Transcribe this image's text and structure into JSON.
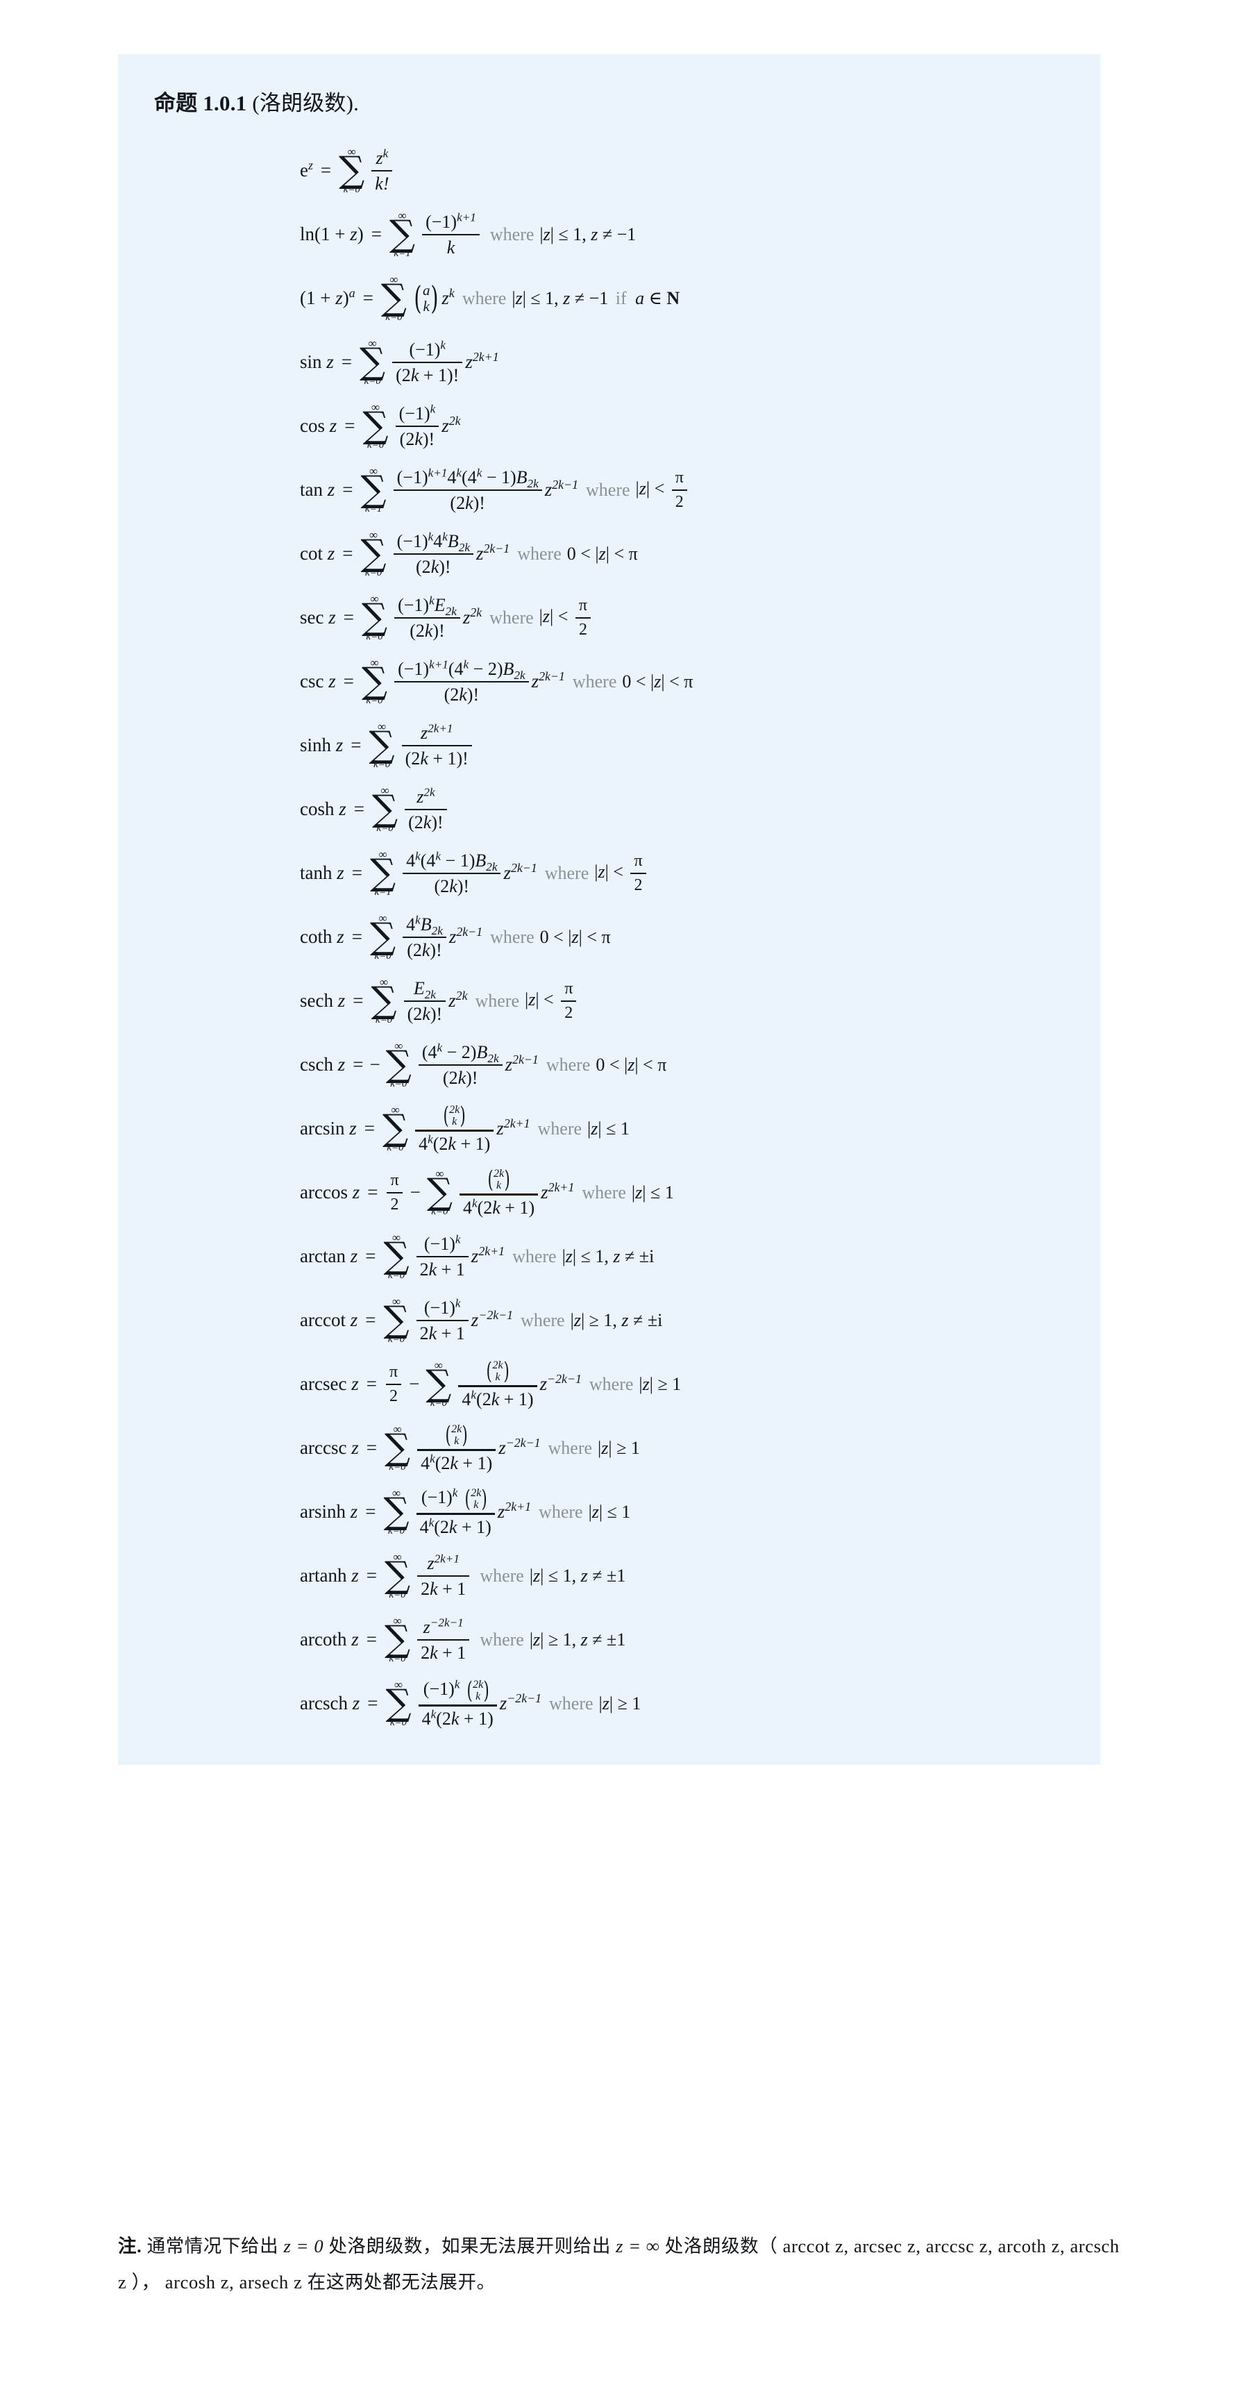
{
  "document": {
    "title_lead": "命题 1.0.1",
    "title_paren": "(洛朗级数).",
    "background_color": "#eaf4fb",
    "text_color": "#12161c",
    "where_color": "#8c9196"
  },
  "formulas": [
    {
      "id": "exp",
      "lhs": "e",
      "lhs_sup": "z",
      "sum_upper": "∞",
      "sum_lower": "k=0",
      "num": "z^k",
      "den": "k!",
      "where": "",
      "condition": ""
    },
    {
      "id": "ln",
      "lhs": "ln(1 + z)",
      "sum_upper": "∞",
      "sum_lower": "k=1",
      "num": "(−1)^{k+1}",
      "den": "k",
      "where": "where",
      "condition": "|z| ≤ 1, z ≠ −1"
    },
    {
      "id": "binomial",
      "lhs": "(1 + z)^a",
      "sum_upper": "∞",
      "sum_lower": "k=0",
      "binom_top": "a",
      "binom_bottom": "k",
      "factor": "z^k",
      "where": "where",
      "condition": "|z| ≤ 1, z ≠ −1 if a ∈ N"
    },
    {
      "id": "sin",
      "lhs": "sin z",
      "sum_upper": "∞",
      "sum_lower": "k=0",
      "num": "(−1)^k",
      "den": "(2k + 1)!",
      "factor": "z^{2k+1}",
      "where": "",
      "condition": ""
    },
    {
      "id": "cos",
      "lhs": "cos z",
      "sum_upper": "∞",
      "sum_lower": "k=0",
      "num": "(−1)^k",
      "den": "(2k)!",
      "factor": "z^{2k}",
      "where": "",
      "condition": ""
    },
    {
      "id": "tan",
      "lhs": "tan z",
      "sum_upper": "∞",
      "sum_lower": "k=1",
      "num": "(−1)^{k+1} 4^k (4^k − 1) B_{2k}",
      "den": "(2k)!",
      "factor": "z^{2k−1}",
      "where": "where",
      "condition": "|z| < π/2"
    },
    {
      "id": "cot",
      "lhs": "cot z",
      "sum_upper": "∞",
      "sum_lower": "k=0",
      "num": "(−1)^k 4^k B_{2k}",
      "den": "(2k)!",
      "factor": "z^{2k−1}",
      "where": "where",
      "condition": "0 < |z| < π"
    },
    {
      "id": "sec",
      "lhs": "sec z",
      "sum_upper": "∞",
      "sum_lower": "k=0",
      "num": "(−1)^k E_{2k}",
      "den": "(2k)!",
      "factor": "z^{2k}",
      "where": "where",
      "condition": "|z| < π/2"
    },
    {
      "id": "csc",
      "lhs": "csc z",
      "sum_upper": "∞",
      "sum_lower": "k=0",
      "num": "(−1)^{k+1} (4^k − 2) B_{2k}",
      "den": "(2k)!",
      "factor": "z^{2k−1}",
      "where": "where",
      "condition": "0 < |z| < π"
    },
    {
      "id": "sinh",
      "lhs": "sinh z",
      "sum_upper": "∞",
      "sum_lower": "k=0",
      "num": "z^{2k+1}",
      "den": "(2k + 1)!",
      "where": "",
      "condition": ""
    },
    {
      "id": "cosh",
      "lhs": "cosh z",
      "sum_upper": "∞",
      "sum_lower": "k=0",
      "num": "z^{2k}",
      "den": "(2k)!",
      "where": "",
      "condition": ""
    },
    {
      "id": "tanh",
      "lhs": "tanh z",
      "sum_upper": "∞",
      "sum_lower": "k=1",
      "num": "4^k (4^k − 1) B_{2k}",
      "den": "(2k)!",
      "factor": "z^{2k−1}",
      "where": "where",
      "condition": "|z| < π/2"
    },
    {
      "id": "coth",
      "lhs": "coth z",
      "sum_upper": "∞",
      "sum_lower": "k=0",
      "num": "4^k B_{2k}",
      "den": "(2k)!",
      "factor": "z^{2k−1}",
      "where": "where",
      "condition": "0 < |z| < π"
    },
    {
      "id": "sech",
      "lhs": "sech z",
      "sum_upper": "∞",
      "sum_lower": "k=0",
      "num": "E_{2k}",
      "den": "(2k)!",
      "factor": "z^{2k}",
      "where": "where",
      "condition": "|z| < π/2"
    },
    {
      "id": "csch",
      "lhs": "csch z",
      "leading_sign": "−",
      "sum_upper": "∞",
      "sum_lower": "k=0",
      "num": "(4^k − 2) B_{2k}",
      "den": "(2k)!",
      "factor": "z^{2k−1}",
      "where": "where",
      "condition": "0 < |z| < π"
    },
    {
      "id": "arcsin",
      "lhs": "arcsin z",
      "sum_upper": "∞",
      "sum_lower": "k=0",
      "num_binom_top": "2k",
      "num_binom_bottom": "k",
      "den": "4^k (2k + 1)",
      "factor": "z^{2k+1}",
      "where": "where",
      "condition": "|z| ≤ 1"
    },
    {
      "id": "arccos",
      "lhs": "arccos z",
      "prefix_frac_num": "π",
      "prefix_frac_den": "2",
      "prefix_sign": "−",
      "sum_upper": "∞",
      "sum_lower": "k=0",
      "num_binom_top": "2k",
      "num_binom_bottom": "k",
      "den": "4^k (2k + 1)",
      "factor": "z^{2k+1}",
      "where": "where",
      "condition": "|z| ≤ 1"
    },
    {
      "id": "arctan",
      "lhs": "arctan z",
      "sum_upper": "∞",
      "sum_lower": "k=0",
      "num": "(−1)^k",
      "den": "2k + 1",
      "factor": "z^{2k+1}",
      "where": "where",
      "condition": "|z| ≤ 1, z ≠ ±i"
    },
    {
      "id": "arccot",
      "lhs": "arccot z",
      "sum_upper": "∞",
      "sum_lower": "k=0",
      "num": "(−1)^k",
      "den": "2k + 1",
      "factor": "z^{−2k−1}",
      "where": "where",
      "condition": "|z| ≥ 1, z ≠ ±i"
    },
    {
      "id": "arcsec",
      "lhs": "arcsec z",
      "prefix_frac_num": "π",
      "prefix_frac_den": "2",
      "prefix_sign": "−",
      "sum_upper": "∞",
      "sum_lower": "k=0",
      "num_binom_top": "2k",
      "num_binom_bottom": "k",
      "den": "4^k (2k + 1)",
      "factor": "z^{−2k−1}",
      "where": "where",
      "condition": "|z| ≥ 1"
    },
    {
      "id": "arccsc",
      "lhs": "arccsc z",
      "sum_upper": "∞",
      "sum_lower": "k=0",
      "num_binom_top": "2k",
      "num_binom_bottom": "k",
      "den": "4^k (2k + 1)",
      "factor": "z^{−2k−1}",
      "where": "where",
      "condition": "|z| ≥ 1"
    },
    {
      "id": "arsinh",
      "lhs": "arsinh z",
      "sum_upper": "∞",
      "sum_lower": "k=0",
      "num": "(−1)^k C(2k,k)",
      "den": "4^k (2k + 1)",
      "factor": "z^{2k+1}",
      "where": "where",
      "condition": "|z| ≤ 1"
    },
    {
      "id": "artanh",
      "lhs": "artanh z",
      "sum_upper": "∞",
      "sum_lower": "k=0",
      "num": "z^{2k+1}",
      "den": "2k + 1",
      "where": "where",
      "condition": "|z| ≤ 1, z ≠ ±1"
    },
    {
      "id": "arcoth",
      "lhs": "arcoth z",
      "sum_upper": "∞",
      "sum_lower": "k=0",
      "num": "z^{−2k−1}",
      "den": "2k + 1",
      "where": "where",
      "condition": "|z| ≥ 1, z ≠ ±1"
    },
    {
      "id": "arcsch",
      "lhs": "arcsch z",
      "sum_upper": "∞",
      "sum_lower": "k=0",
      "num": "(−1)^k C(2k,k)",
      "den": "4^k (2k + 1)",
      "factor": "z^{−2k−1}",
      "where": "where",
      "condition": "|z| ≥ 1"
    }
  ],
  "note": {
    "lead": "注.",
    "line1_part1": "通常情况下给出",
    "line1_math1": "z = 0",
    "line1_part2": "处洛朗级数，如果无法展开则给出",
    "line1_math2": "z = ∞",
    "line1_part3": "处洛朗级数（",
    "line2_math1": "arccot z, arcsec z, arccsc z, arcoth z, arcsch z",
    "line2_part1": "），",
    "line2_math2": "arcosh z, arsech z",
    "line2_part2": "在这两处都无法展开。"
  }
}
